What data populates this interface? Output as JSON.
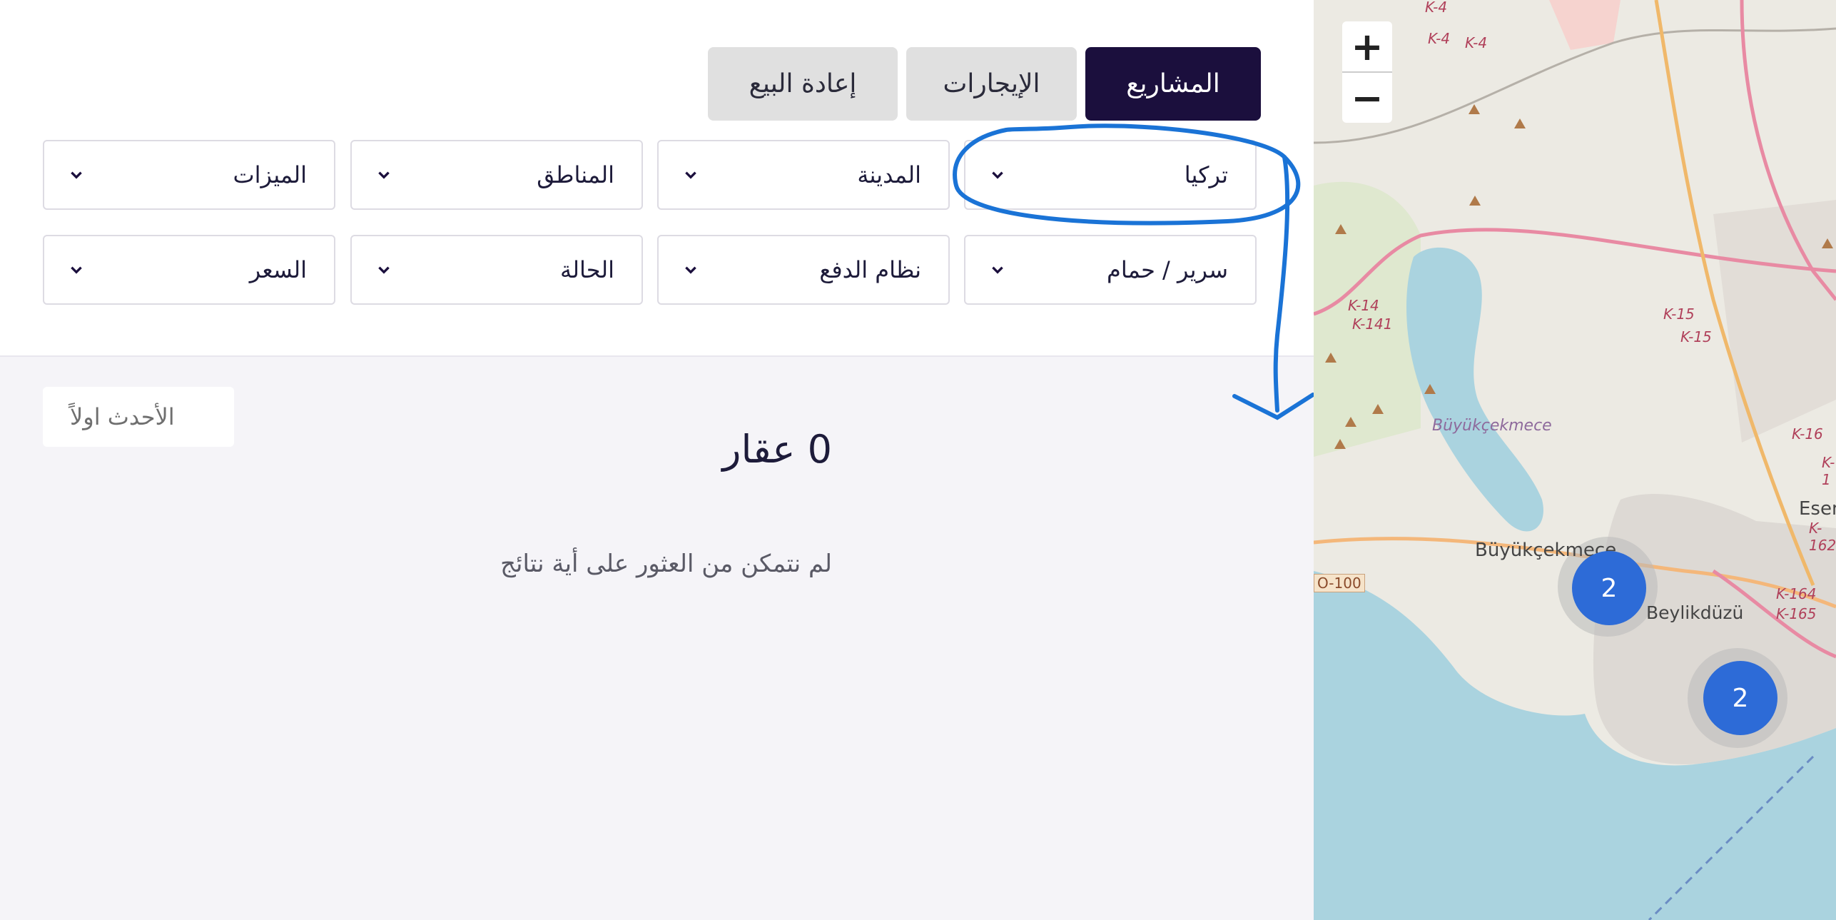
{
  "tabs": [
    {
      "label": "المشاريع",
      "active": true
    },
    {
      "label": "الإيجارات",
      "active": false
    },
    {
      "label": "إعادة البيع",
      "active": false
    }
  ],
  "filters": {
    "row1": [
      "تركيا",
      "المدينة",
      "المناطق",
      "الميزات"
    ],
    "row2": [
      "سرير / حمام",
      "نظام الدفع",
      "الحالة",
      "السعر"
    ]
  },
  "sort": {
    "label": "الأحدث اولاً"
  },
  "results": {
    "count_text": "0 عقار",
    "empty_text": "لم نتمكن من العثور على أية نتائج"
  },
  "map": {
    "zoom_in": "+",
    "zoom_out": "−",
    "place_labels": [
      "Büyükçekmece",
      "Büyükçekmece",
      "Beylikdüzü",
      "Esenyurt"
    ],
    "road_labels": [
      "K-4",
      "K-4",
      "K-4",
      "K-14",
      "K-141",
      "K-15",
      "K-15",
      "K-16",
      "K-164",
      "K-165",
      "K-162",
      "K-1",
      "O-100"
    ],
    "clusters": [
      "2",
      "2"
    ]
  },
  "colors": {
    "accent_dark": "#1b0f3d",
    "annotation_blue": "#1a73d6",
    "cluster_blue": "#2d6bd7",
    "sea": "#aad3df"
  }
}
